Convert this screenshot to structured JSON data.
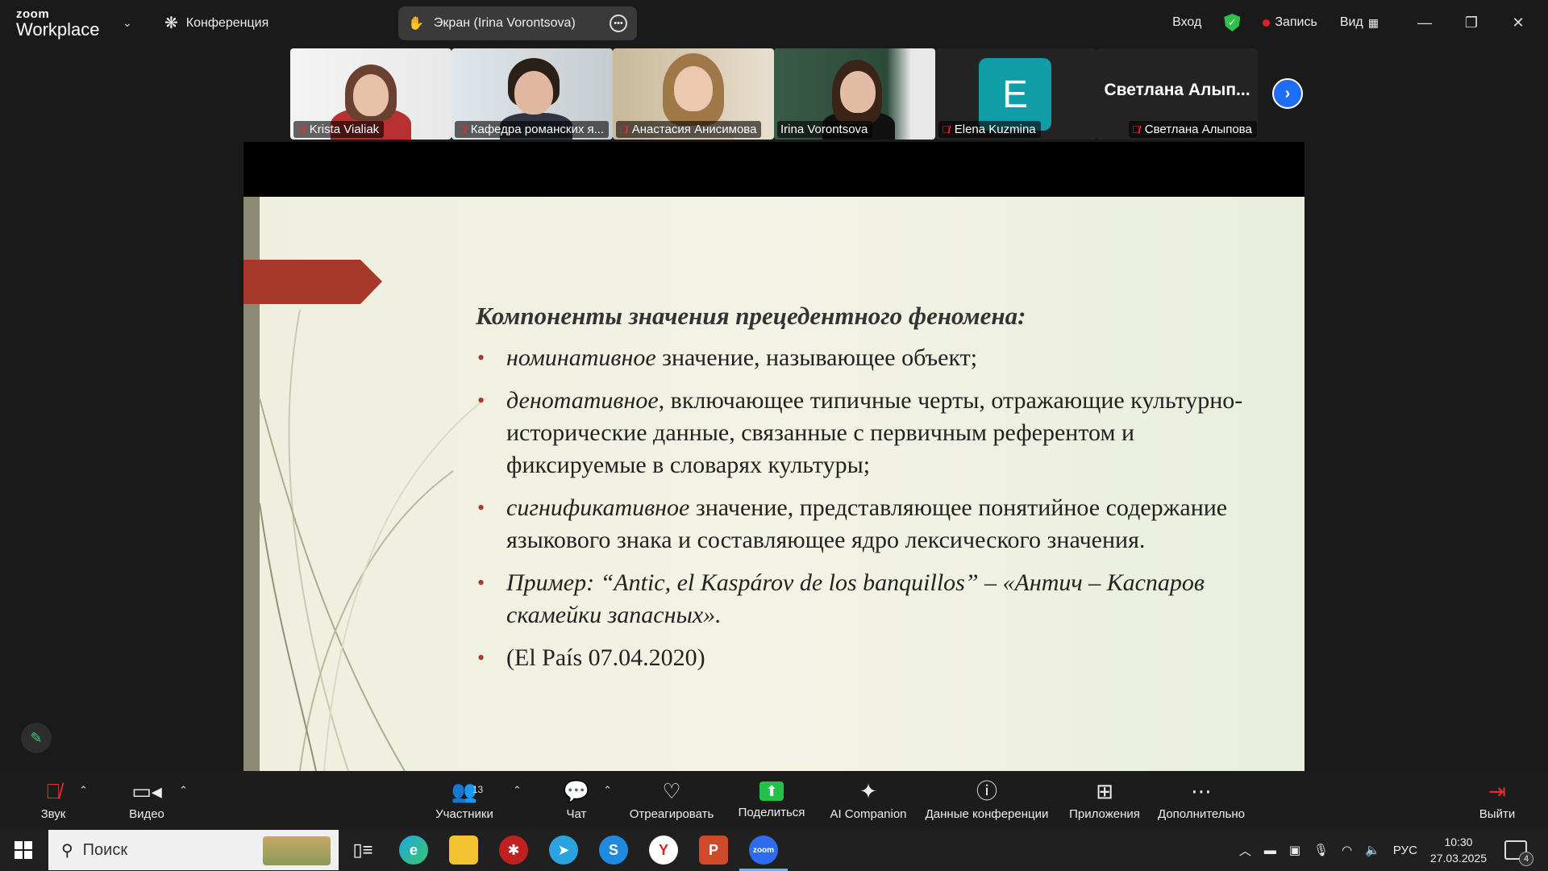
{
  "titlebar": {
    "logo_top": "zoom",
    "logo_bottom": "Workplace",
    "meeting_label": "Конференция",
    "share_indicator": "Экран (Irina Vorontsova)",
    "signin": "Вход",
    "record": "Запись",
    "view": "Вид"
  },
  "participants": [
    {
      "name": "Krista Vialiak",
      "muted": true
    },
    {
      "name": "Кафедра романских я...",
      "muted": true
    },
    {
      "name": "Анастасия Анисимова",
      "muted": true
    },
    {
      "name": "Irina Vorontsova",
      "muted": false,
      "active": true
    },
    {
      "name": "Elena Kuzmina",
      "muted": true,
      "avatar_letter": "E"
    },
    {
      "name": "Светлана Алыпова",
      "muted": true,
      "display_title": "Светлана  Алып..."
    }
  ],
  "slide": {
    "heading": "Компоненты значения прецедентного феномена:",
    "bullets": [
      {
        "italic": "номинативное",
        "text": " значение, называющее объект;"
      },
      {
        "italic": " денотативное",
        "text": ", включающее типичные черты, отражающие культурно-исторические данные, связанные с первичным референтом и фиксируемые в словарях культуры;"
      },
      {
        "italic": "сигнификативное",
        "text": " значение, представляющее понятийное содержание языкового знака и составляющее ядро лексического значения."
      },
      {
        "italic": "Пример: “Antic, el Kaspárov de los banquillos” –     «Антич –   Каспаров скамейки   запасных».",
        "text": ""
      },
      {
        "italic": "",
        "text": " (El País 07.04.2020)"
      }
    ]
  },
  "toolbar": {
    "audio": "Звук",
    "video": "Видео",
    "participants": "Участники",
    "participants_count": "13",
    "chat": "Чат",
    "react": "Отреагировать",
    "share": "Поделиться",
    "ai": "AI Companion",
    "info": "Данные конференции",
    "apps": "Приложения",
    "more": "Дополнительно",
    "leave": "Выйти"
  },
  "taskbar": {
    "search_placeholder": "Поиск",
    "lang": "РУС",
    "time": "10:30",
    "date": "27.03.2025",
    "notifications": "4"
  },
  "colors": {
    "accent_green": "#2ed47a",
    "slide_accent": "#a7392a",
    "share_green": "#24c04a",
    "next_blue": "#1e6ef5"
  }
}
